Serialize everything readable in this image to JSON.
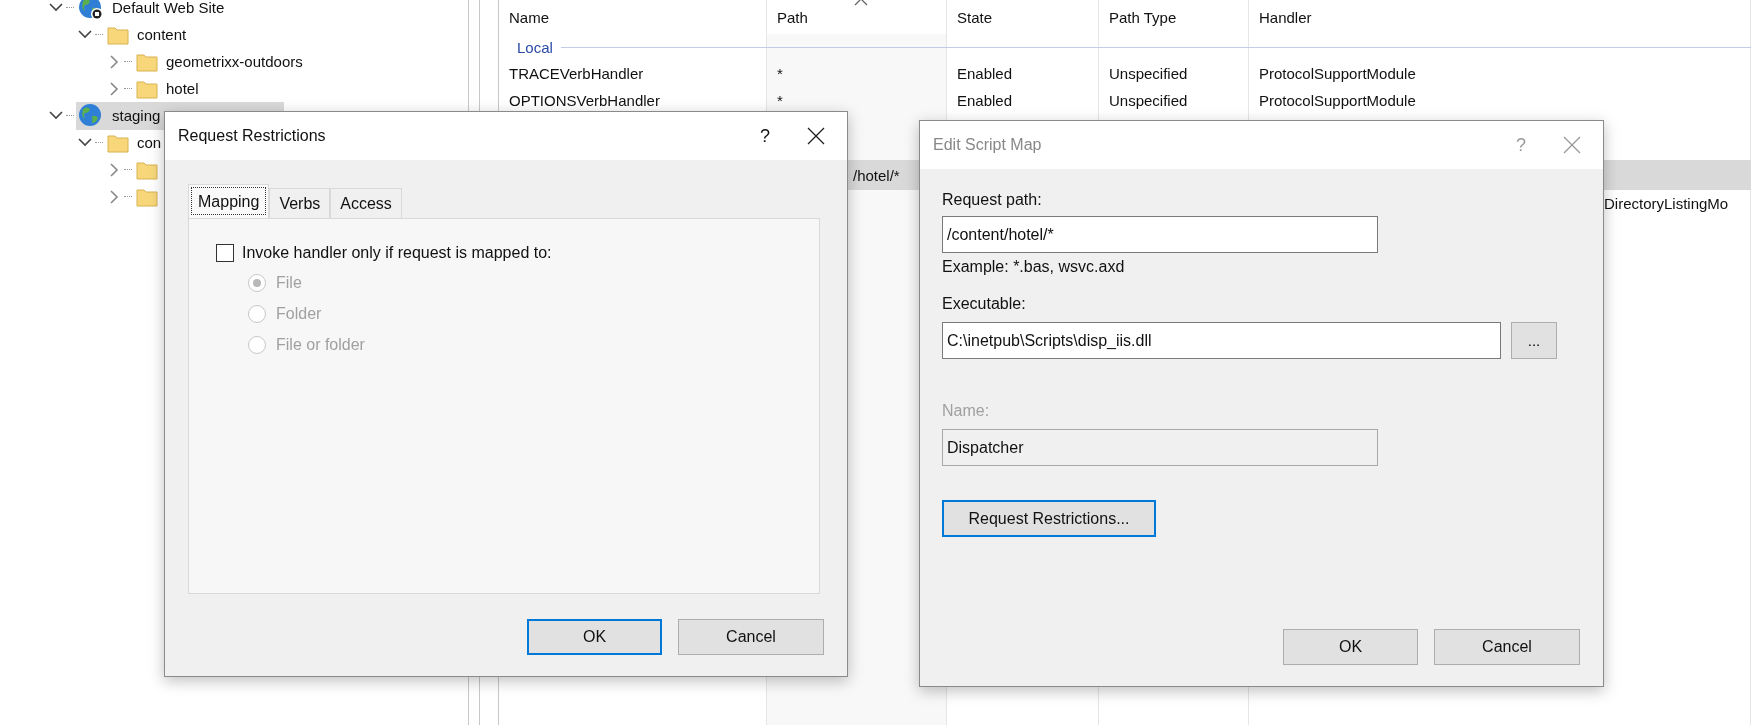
{
  "tree": [
    {
      "label": "Default Web Site",
      "kind": "site",
      "stopped": true,
      "expanded": true,
      "selected": false,
      "children": [
        {
          "label": "content",
          "kind": "folder",
          "expanded": true,
          "selected": false,
          "children": [
            {
              "label": "geometrixx-outdoors",
              "kind": "folder",
              "expanded": false,
              "selected": false
            },
            {
              "label": "hotel",
              "kind": "folder",
              "expanded": false,
              "selected": false
            }
          ]
        }
      ]
    },
    {
      "label": "staging",
      "kind": "site",
      "stopped": false,
      "expanded": true,
      "selected": true,
      "children": [
        {
          "label": "con",
          "kind": "folder",
          "expanded": true,
          "selected": false,
          "children": [
            {
              "kind": "folder",
              "expanded": false,
              "selected": false
            },
            {
              "kind": "folder",
              "expanded": false,
              "selected": false
            }
          ]
        }
      ]
    }
  ],
  "handler_list": {
    "columns": [
      "Name",
      "Path",
      "State",
      "Path Type",
      "Handler"
    ],
    "groups": [
      {
        "label": "Local",
        "rows": [
          {
            "name": "TRACEVerbHandler",
            "path": "*",
            "state": "Enabled",
            "path_type": "Unspecified",
            "handler": "ProtocolSupportModule",
            "selected": false
          },
          {
            "name": "OPTIONSVerbHandler",
            "path": "*",
            "state": "Enabled",
            "path_type": "Unspecified",
            "handler": "ProtocolSupportModule",
            "selected": false
          },
          {
            "path": "/hotel/*",
            "selected": true
          },
          {
            "handler": "DirectoryListingMo",
            "selected": false
          }
        ]
      }
    ]
  },
  "request_restrictions": {
    "title": "Request Restrictions",
    "active": true,
    "help": "?",
    "tabs": [
      {
        "label": "Mapping",
        "selected": true
      },
      {
        "label": "Verbs",
        "selected": false
      },
      {
        "label": "Access",
        "selected": false
      }
    ],
    "checkbox": {
      "label": "Invoke handler only if request is mapped to:",
      "checked": false
    },
    "options": [
      {
        "label": "File",
        "selected": true,
        "disabled": true
      },
      {
        "label": "Folder",
        "selected": false,
        "disabled": true
      },
      {
        "label": "File or folder",
        "selected": false,
        "disabled": true
      }
    ],
    "buttons": [
      {
        "label": "OK",
        "default": true
      },
      {
        "label": "Cancel",
        "default": false
      }
    ]
  },
  "edit_script_map": {
    "title": "Edit Script Map",
    "active": false,
    "help": "?",
    "request_path": {
      "label": "Request path:",
      "value": "/content/hotel/*"
    },
    "example": "Example: *.bas, wsvc.axd",
    "executable": {
      "label": "Executable:",
      "value": "C:\\inetpub\\Scripts\\disp_iis.dll"
    },
    "browse_button": "...",
    "name": {
      "label": "Name:",
      "value": "Dispatcher",
      "disabled": true
    },
    "restrictions_button": {
      "label": "Request Restrictions...",
      "focused": true
    },
    "buttons": [
      {
        "label": "OK",
        "default": false
      },
      {
        "label": "Cancel",
        "default": false
      }
    ]
  }
}
